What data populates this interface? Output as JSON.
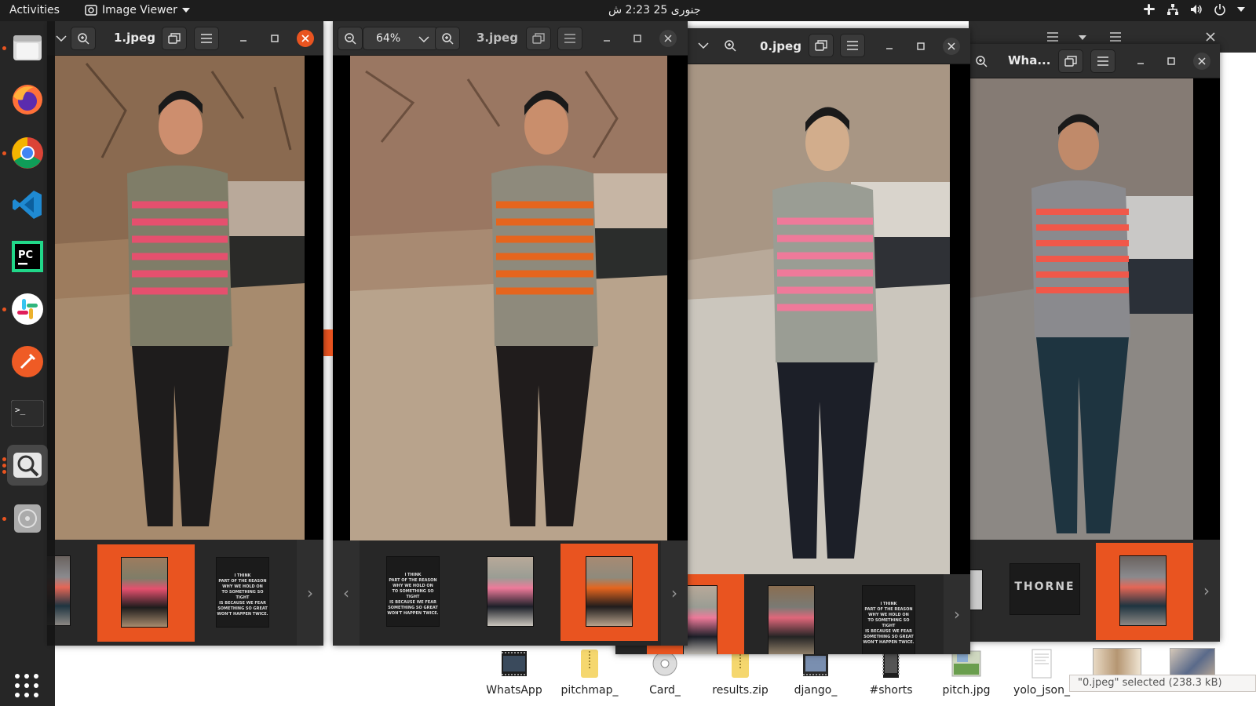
{
  "topbar": {
    "activities": "Activities",
    "app_name": "Image Viewer",
    "clock": "جنوری 25  2:23 ش"
  },
  "dock": {
    "items": [
      "Files",
      "Firefox",
      "Google Chrome",
      "Visual Studio Code",
      "PyCharm",
      "Slack",
      "Postman",
      "Terminal",
      "Image Viewer",
      "Disks",
      "Show Applications"
    ]
  },
  "windows": {
    "w1": {
      "title": "1.jpeg"
    },
    "w2": {
      "title": "3.jpeg",
      "zoom": "64%"
    },
    "w3": {
      "title": "0.jpeg"
    },
    "w4": {
      "title": "Wha..."
    }
  },
  "gallery": {
    "quote_lines": [
      "I THINK",
      "PART OF THE REASON",
      "WHY WE HOLD ON",
      "TO SOMETHING SO TIGHT",
      "IS BECAUSE WE FEAR",
      "SOMETHING SO GREAT",
      "WON'T HAPPEN TWICE."
    ],
    "thorne": "THORNE",
    "next_arrow": "›",
    "prev_arrow": "‹"
  },
  "files": [
    {
      "name": "WhatsApp"
    },
    {
      "name": "pitchmap_"
    },
    {
      "name": "Card_"
    },
    {
      "name": "results.zip"
    },
    {
      "name": "django_"
    },
    {
      "name": "#shorts"
    },
    {
      "name": "pitch.jpg"
    },
    {
      "name": "yolo_json_"
    }
  ],
  "status": {
    "text": "\"0.jpeg\" selected  (238.3 kB)"
  },
  "colors": {
    "accent": "#e95420",
    "topbar": "#1d1d1d",
    "headerbar": "#2d2d2d"
  }
}
